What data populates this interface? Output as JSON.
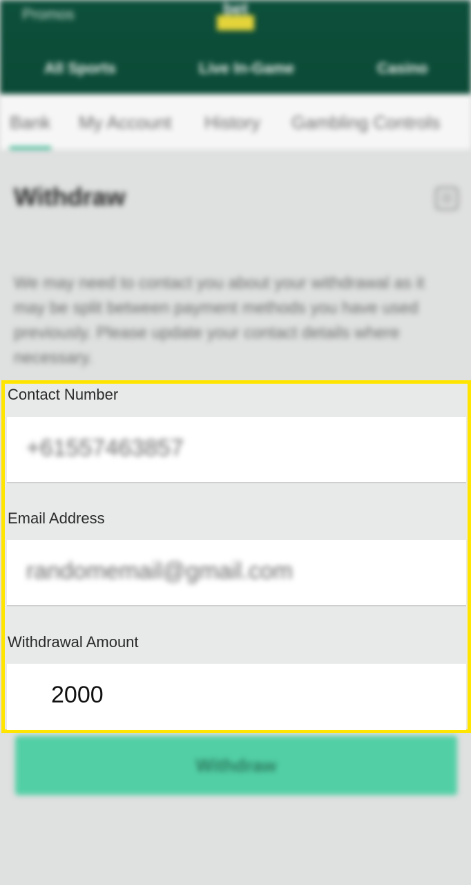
{
  "header": {
    "left_link": "Promos",
    "logo_text": "bet",
    "nav": [
      "All Sports",
      "Live In-Game",
      "Casino"
    ]
  },
  "account_tabs": [
    "Bank",
    "My Account",
    "History",
    "Gambling Controls"
  ],
  "section": {
    "title": "Withdraw",
    "info_text": "We may need to contact you about your withdrawal as it may be split between payment methods you have used previously. Please update your contact details where necessary."
  },
  "form": {
    "contact_label": "Contact Number",
    "contact_value": "+61557463857",
    "email_label": "Email Address",
    "email_value": "randomemail@gmail.com",
    "amount_label": "Withdrawal Amount",
    "amount_value": "2000"
  },
  "withdraw_button_label": "Withdraw",
  "colors": {
    "header_bg": "#0c4f3a",
    "accent": "#20b183",
    "button_bg": "#52cfa5",
    "highlight": "#ffe500"
  }
}
